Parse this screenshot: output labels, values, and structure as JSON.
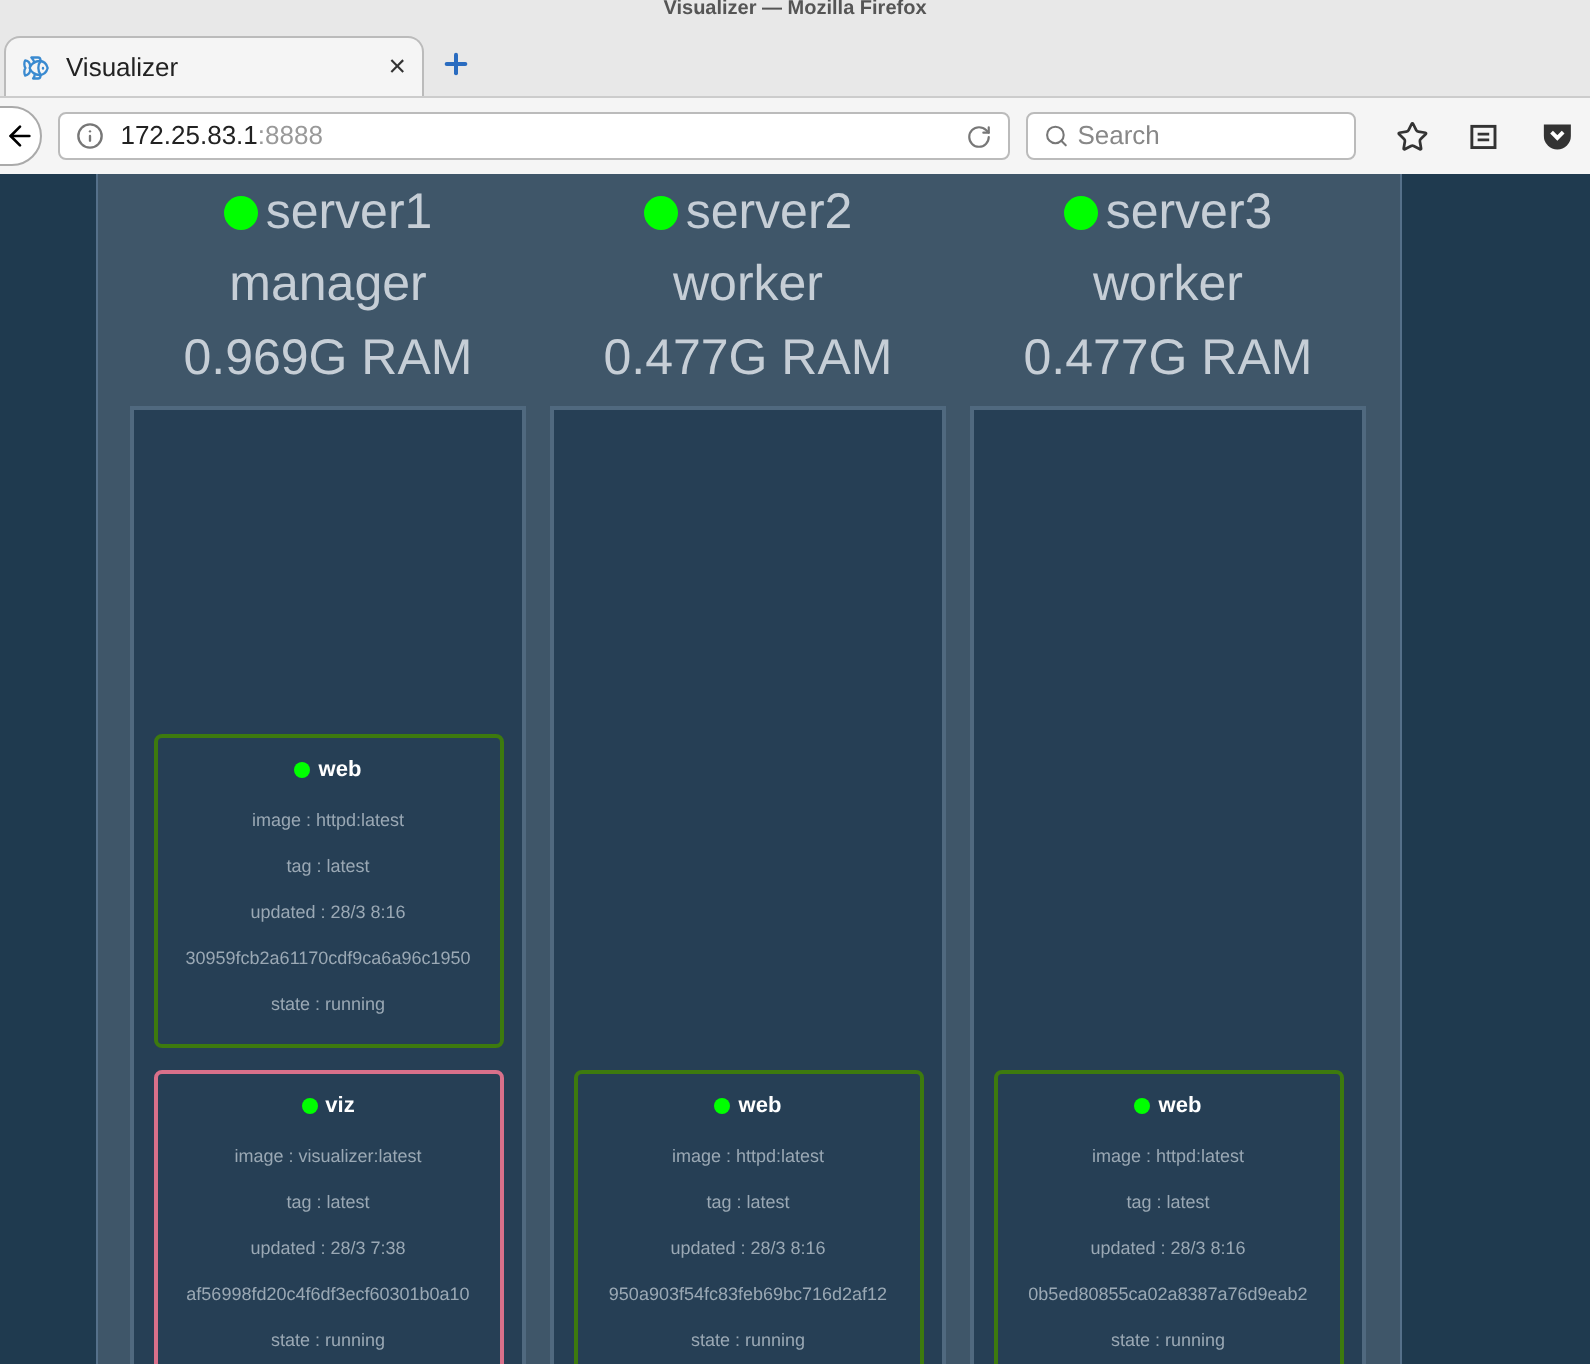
{
  "window": {
    "title": "Visualizer — Mozilla Firefox"
  },
  "tabs": [
    {
      "label": "Visualizer",
      "selected": true,
      "close": "×"
    }
  ],
  "address_bar": {
    "host": "172.25.83.1",
    "port": ":8888"
  },
  "search": {
    "placeholder": "Search"
  },
  "nodes": [
    {
      "name": "server1",
      "role": "manager",
      "ram": "0.969G RAM",
      "services": [
        {
          "name": "web",
          "color": "#3d7a0e",
          "lines": [
            "image : httpd:latest",
            "tag : latest",
            "updated : 28/3 8:16",
            "30959fcb2a61170cdf9ca6a96c1950",
            "state : running"
          ]
        },
        {
          "name": "viz",
          "color": "#d9708a",
          "lines": [
            "image : visualizer:latest",
            "tag : latest",
            "updated : 28/3 7:38",
            "af56998fd20c4f6df3ecf60301b0a10",
            "state : running"
          ]
        }
      ]
    },
    {
      "name": "server2",
      "role": "worker",
      "ram": "0.477G RAM",
      "services": [
        {
          "name": "web",
          "color": "#3d7a0e",
          "lines": [
            "image : httpd:latest",
            "tag : latest",
            "updated : 28/3 8:16",
            "950a903f54fc83feb69bc716d2af12",
            "state : running"
          ]
        }
      ]
    },
    {
      "name": "server3",
      "role": "worker",
      "ram": "0.477G RAM",
      "services": [
        {
          "name": "web",
          "color": "#3d7a0e",
          "lines": [
            "image : httpd:latest",
            "tag : latest",
            "updated : 28/3 8:16",
            "0b5ed80855ca02a8387a76d9eab2",
            "state : running"
          ]
        }
      ]
    }
  ]
}
